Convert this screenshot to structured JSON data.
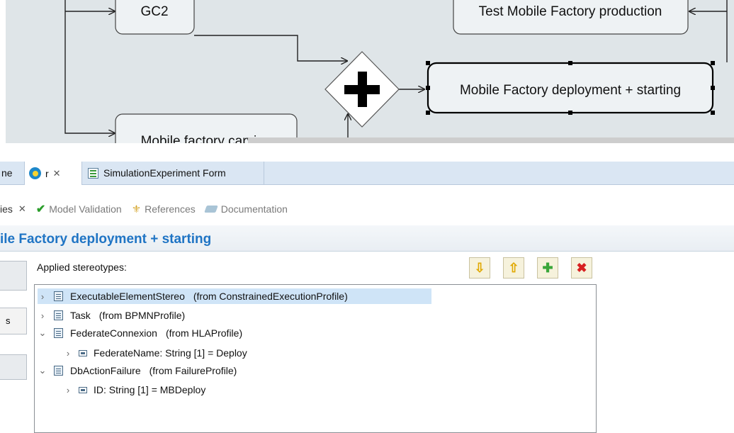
{
  "diagram": {
    "tasks": {
      "gc2": "GC2",
      "test_mobile": "Test Mobile Factory production",
      "mobile_deploy": "Mobile Factory deployment + starting",
      "mobile_carving": "Mobile factory carving"
    }
  },
  "editor_tabs": {
    "partial_label": "ne",
    "active_label": "r",
    "active_close": "✕",
    "simulation_label": "SimulationExperiment Form"
  },
  "view_tabs": {
    "properties_label": "ies",
    "properties_close": "✕",
    "validation_label": "Model Validation",
    "references_label": "References",
    "documentation_label": "Documentation"
  },
  "properties": {
    "title": "ile Factory deployment + starting",
    "section_partial": "s",
    "applied_label": "Applied stereotypes:"
  },
  "toolbar": {
    "down_icon": "arrow-down-icon",
    "up_icon": "arrow-up-icon",
    "add_icon": "plus-icon",
    "remove_icon": "delete-icon"
  },
  "stereotypes": [
    {
      "name": "ExecutableElementStereo",
      "from": "(from ConstrainedExecutionProfile)",
      "selected": true,
      "expanded": false
    },
    {
      "name": "Task",
      "from": "(from BPMNProfile)",
      "selected": false,
      "expanded": false
    },
    {
      "name": "FederateConnexion",
      "from": "(from HLAProfile)",
      "selected": false,
      "expanded": true,
      "property": "FederateName: String [1] = Deploy"
    },
    {
      "name": "DbActionFailure",
      "from": "(from FailureProfile)",
      "selected": false,
      "expanded": true,
      "property": "ID: String [1] = MBDeploy"
    }
  ]
}
